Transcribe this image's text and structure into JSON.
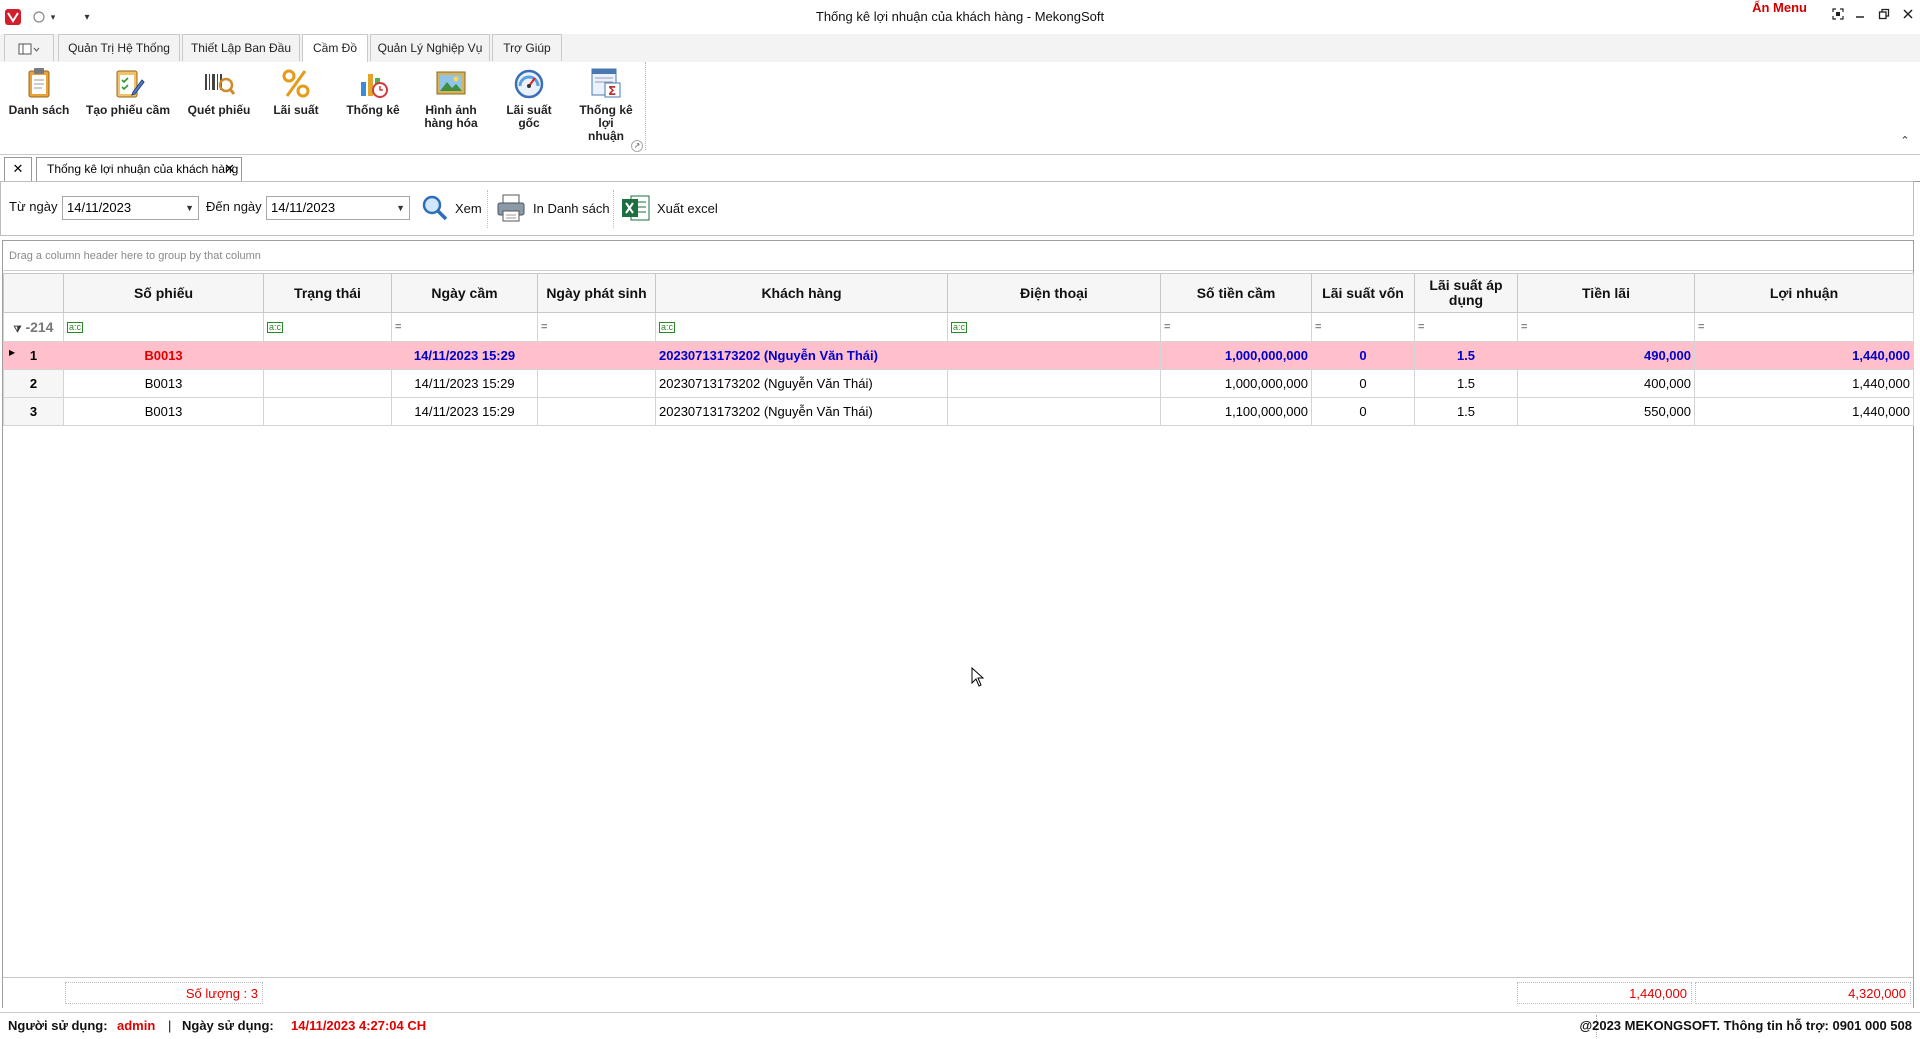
{
  "window": {
    "title": "Thống kê lợi nhuận của khách hàng - MekongSoft",
    "hide_menu": "Ẩn Menu",
    "qat_dropdown": "▾"
  },
  "ribbon": {
    "tabs": [
      {
        "label": "Quản Trị Hệ Thống"
      },
      {
        "label": "Thiết Lập Ban Đầu"
      },
      {
        "label": "Cầm Đồ"
      },
      {
        "label": "Quản Lý Nghiệp Vụ"
      },
      {
        "label": "Trợ Giúp"
      }
    ],
    "buttons": [
      {
        "label": "Danh sách",
        "icon": "clipboard-icon"
      },
      {
        "label": "Tạo phiếu cầm",
        "icon": "checklist-pencil-icon"
      },
      {
        "label": "Quét phiếu",
        "icon": "barcode-scan-icon"
      },
      {
        "label": "Lãi suất",
        "icon": "percent-icon"
      },
      {
        "label": "Thống kê",
        "icon": "chart-clock-icon"
      },
      {
        "label": "Hình ảnh hàng hóa",
        "icon": "picture-icon"
      },
      {
        "label": "Lãi suất gốc",
        "icon": "gauge-icon"
      },
      {
        "label": "Thống kê lợi nhuận",
        "icon": "report-sigma-icon"
      }
    ]
  },
  "doc_tab": {
    "label": "Thống kê lợi nhuận của khách hàng"
  },
  "filter": {
    "from_label": "Từ ngày",
    "from_value": "14/11/2023",
    "to_label": "Đến ngày",
    "to_value": "14/11/2023",
    "view_label": "Xem",
    "print_label": "In Danh sách",
    "excel_label": "Xuất excel"
  },
  "grid": {
    "group_hint": "Drag a column header here to group by that column",
    "filter_row_label": "-214",
    "columns": [
      {
        "label": "Số phiếu"
      },
      {
        "label": "Trạng thái"
      },
      {
        "label": "Ngày cầm"
      },
      {
        "label": "Ngày phát sinh"
      },
      {
        "label": "Khách hàng"
      },
      {
        "label": "Điện thoại"
      },
      {
        "label": "Số tiền cầm"
      },
      {
        "label": "Lãi suất vốn"
      },
      {
        "label": "Lãi suất áp dụng"
      },
      {
        "label": "Tiền lãi"
      },
      {
        "label": "Lợi nhuận"
      }
    ],
    "rows": [
      {
        "n": "1",
        "so_phieu": "B0013",
        "trang_thai": "",
        "ngay_cam": "14/11/2023 15:29",
        "ngay_phat_sinh": "",
        "khach_hang": "20230713173202 (Nguyễn Văn Thái)",
        "dien_thoai": "",
        "so_tien_cam": "1,000,000,000",
        "lai_suat_von": "0",
        "lai_suat_ap_dung": "1.5",
        "tien_lai": "490,000",
        "loi_nhuan": "1,440,000"
      },
      {
        "n": "2",
        "so_phieu": "B0013",
        "trang_thai": "",
        "ngay_cam": "14/11/2023 15:29",
        "ngay_phat_sinh": "",
        "khach_hang": "20230713173202 (Nguyễn Văn Thái)",
        "dien_thoai": "",
        "so_tien_cam": "1,000,000,000",
        "lai_suat_von": "0",
        "lai_suat_ap_dung": "1.5",
        "tien_lai": "400,000",
        "loi_nhuan": "1,440,000"
      },
      {
        "n": "3",
        "so_phieu": "B0013",
        "trang_thai": "",
        "ngay_cam": "14/11/2023 15:29",
        "ngay_phat_sinh": "",
        "khach_hang": "20230713173202 (Nguyễn Văn Thái)",
        "dien_thoai": "",
        "so_tien_cam": "1,100,000,000",
        "lai_suat_von": "0",
        "lai_suat_ap_dung": "1.5",
        "tien_lai": "550,000",
        "loi_nhuan": "1,440,000"
      }
    ],
    "totals": {
      "count": "Số lượng : 3",
      "tien_lai": "1,440,000",
      "loi_nhuan": "4,320,000"
    }
  },
  "status": {
    "user_label": "Người sử dụng:",
    "user_value": "admin",
    "separator": "|",
    "date_label": "Ngày sử dụng:",
    "date_value": "14/11/2023 4:27:04 CH",
    "copyright": "@2023 MEKONGSOFT. Thông tin hỗ trợ: 0901 000 508"
  },
  "colors": {
    "accent_red": "#e00000",
    "selected_row_bg": "#ffc0cb",
    "selected_row_text": "#0000cc"
  }
}
